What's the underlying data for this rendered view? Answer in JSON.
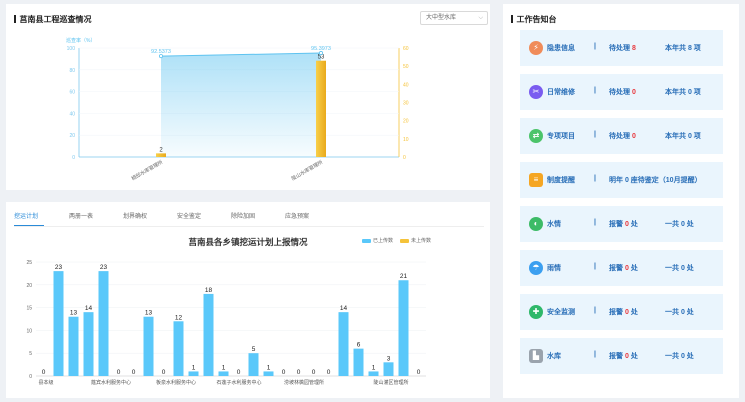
{
  "top_panel": {
    "title": "莒南县工程巡查情况",
    "dropdown": {
      "value": "大中型水库"
    }
  },
  "chart_top": {
    "type": "bar+line",
    "ylabel_left": "巡查率（%）",
    "left_ticks": [
      "0",
      "20",
      "40",
      "60",
      "80",
      "100"
    ],
    "right_ticks": [
      "0",
      "10",
      "20",
      "30",
      "40",
      "50",
      "60"
    ],
    "categories": [
      "相邸水库管理所",
      "陡山水库管理所"
    ],
    "rate_values": [
      92.5373,
      95.3973
    ],
    "rate_labels": [
      "92.5373",
      "95.3973"
    ],
    "bar_values": [
      2,
      53
    ],
    "bar_labels": [
      "2",
      "53"
    ],
    "colors": {
      "line": "#5ec3f0",
      "bar": "#f5c33a"
    }
  },
  "bottom_panel": {
    "tabs": [
      "挖运计划",
      "两册一表",
      "划界确权",
      "安全鉴定",
      "除险加固",
      "应急预案"
    ],
    "active_tab": 0,
    "chart_title": "莒南县各乡镇挖运计划上报情况",
    "legend": [
      "已上传数",
      "未上传数"
    ]
  },
  "chart_data": {
    "type": "bar",
    "title": "莒南县各乡镇挖运计划上报情况",
    "ylim": [
      0,
      25
    ],
    "yticks": [
      "0",
      "5",
      "10",
      "15",
      "20",
      "25"
    ],
    "x_labels": [
      "县本级",
      "筵宾水利服务中心",
      "板泉水利服务中心",
      "石莲子水利服务中心",
      "涝坡林檎园管理所",
      "陡山灌区管理所"
    ],
    "series": [
      {
        "name": "已上传数",
        "values": [
          0,
          23,
          13,
          14,
          23,
          0,
          0,
          13,
          0,
          12,
          1,
          18,
          1,
          0,
          5,
          1,
          0,
          0,
          0,
          0,
          14,
          6,
          1,
          3,
          21,
          0
        ]
      },
      {
        "name": "未上传数",
        "values": [
          0,
          0,
          0,
          0,
          0,
          0,
          0,
          0,
          0,
          0,
          0,
          0,
          0,
          0,
          0,
          0,
          0,
          0,
          0,
          0,
          0,
          0,
          0,
          0,
          0,
          0
        ]
      }
    ],
    "colors": {
      "uploaded": "#5ac8fa",
      "not_uploaded": "#f5c33a"
    }
  },
  "right_panel": {
    "title": "工作告知台",
    "cards": [
      {
        "icon": "warning-icon",
        "glyph": "⚡",
        "color": "#f08c5a",
        "name": "隐患信息",
        "sep": "|",
        "pre": "待处理",
        "num": "8",
        "post": "",
        "extra": "本年共 8 项"
      },
      {
        "icon": "wrench-icon",
        "glyph": "✂",
        "color": "#7a5cf0",
        "name": "日常维修",
        "sep": "|",
        "pre": "待处理",
        "num": "0",
        "post": "",
        "extra": "本年共 0 项"
      },
      {
        "icon": "link-icon",
        "glyph": "⇄",
        "color": "#4cc46a",
        "name": "专项项目",
        "sep": "|",
        "pre": "待处理",
        "num": "0",
        "post": "",
        "extra": "本年共 0 项"
      },
      {
        "icon": "document-icon",
        "glyph": "≡",
        "color": "#f5a623",
        "name": "制度提醒",
        "sep": "|",
        "full": "明年 0 座待鉴定（10月提醒）"
      },
      {
        "icon": "water-icon",
        "glyph": "◐",
        "color": "#3dbb67",
        "name": "水情",
        "sep": "|",
        "pre": "报警",
        "num": "0",
        "post": "处",
        "extra": "一共 0 处"
      },
      {
        "icon": "rain-icon",
        "glyph": "☂",
        "color": "#3b9ff0",
        "name": "雨情",
        "sep": "|",
        "pre": "报警",
        "num": "0",
        "post": "处",
        "extra": "一共 0 处"
      },
      {
        "icon": "shield-icon",
        "glyph": "✚",
        "color": "#2fb86a",
        "name": "安全监测",
        "sep": "|",
        "pre": "报警",
        "num": "0",
        "post": "处",
        "extra": "一共 0 处"
      },
      {
        "icon": "reservoir-icon",
        "glyph": "▙",
        "color": "#9aa3ad",
        "name": "水库",
        "sep": "|",
        "pre": "报警",
        "num": "0",
        "post": "处",
        "extra": "一共 0 处"
      }
    ]
  }
}
